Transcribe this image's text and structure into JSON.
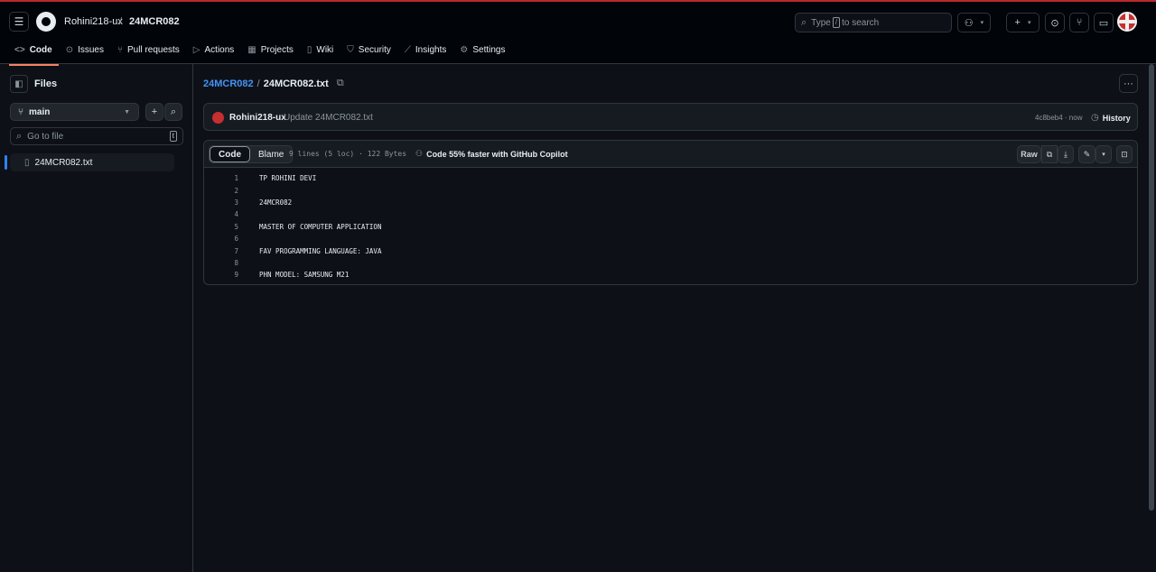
{
  "header": {
    "owner": "Rohini218-ux",
    "separator": "/",
    "repo": "24MCR082",
    "search": {
      "prefix": "Type",
      "key": "/",
      "suffix": "to search"
    }
  },
  "tabs": [
    {
      "label": "Code",
      "icon": "code-icon",
      "glyph": "<>"
    },
    {
      "label": "Issues",
      "icon": "issue-icon",
      "glyph": "⊙"
    },
    {
      "label": "Pull requests",
      "icon": "pull-request-icon",
      "glyph": "⑂"
    },
    {
      "label": "Actions",
      "icon": "play-icon",
      "glyph": "▷"
    },
    {
      "label": "Projects",
      "icon": "table-icon",
      "glyph": "▦"
    },
    {
      "label": "Wiki",
      "icon": "book-icon",
      "glyph": "▯"
    },
    {
      "label": "Security",
      "icon": "shield-icon",
      "glyph": "⛉"
    },
    {
      "label": "Insights",
      "icon": "graph-icon",
      "glyph": "⟋"
    },
    {
      "label": "Settings",
      "icon": "gear-icon",
      "glyph": "⚙"
    }
  ],
  "sidebar": {
    "title": "Files",
    "branch": "main",
    "goto_placeholder": "Go to file",
    "goto_shortcut": "t",
    "files": [
      "24MCR082.txt"
    ]
  },
  "file": {
    "repo_link": "24MCR082",
    "separator": "/",
    "name": "24MCR082.txt"
  },
  "commit": {
    "author": "Rohini218-ux",
    "message": "Update 24MCR082.txt",
    "sha_time": "4c8beb4 · now",
    "history_label": "History"
  },
  "code": {
    "tab_code": "Code",
    "tab_blame": "Blame",
    "meta": "9 lines (5 loc) · 122 Bytes",
    "copilot": "Code 55% faster with GitHub Copilot",
    "raw_label": "Raw",
    "lines": [
      {
        "n": "1",
        "t": "TP ROHINI DEVI"
      },
      {
        "n": "2",
        "t": ""
      },
      {
        "n": "3",
        "t": "24MCR082"
      },
      {
        "n": "4",
        "t": ""
      },
      {
        "n": "5",
        "t": "MASTER OF COMPUTER APPLICATION"
      },
      {
        "n": "6",
        "t": ""
      },
      {
        "n": "7",
        "t": "FAV PROGRAMMING LANGUAGE: JAVA"
      },
      {
        "n": "8",
        "t": ""
      },
      {
        "n": "9",
        "t": "PHN MODEL: SAMSUNG M21"
      }
    ]
  },
  "colors": {
    "background": "#0d1117",
    "accent_tab": "#f78166",
    "link": "#4493f8",
    "top_border": "#b9292e"
  }
}
